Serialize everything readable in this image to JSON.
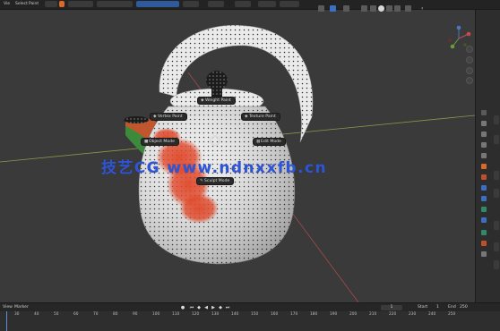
{
  "menubar": {
    "items": [
      "Vie",
      "Select",
      "Paint"
    ]
  },
  "pie_menu": {
    "top": "Weight Paint",
    "upper_left": "Vertex Paint",
    "upper_right": "Texture Paint",
    "left": "Object Mode",
    "right": "Edit Mode",
    "bottom": "Sculpt Mode"
  },
  "watermark": "技艺CG www.ndnxxfb.cn",
  "timeline": {
    "view_label": "View",
    "marker_label": "Marker",
    "current_frame": "1",
    "start_label": "Start",
    "start_value": "1",
    "end_label": "End",
    "end_value": "250"
  },
  "ruler_ticks": [
    "30",
    "40",
    "50",
    "60",
    "70",
    "80",
    "90",
    "100",
    "110",
    "120",
    "130",
    "140",
    "150",
    "160",
    "170",
    "180",
    "190",
    "200",
    "210",
    "220",
    "230",
    "240",
    "250"
  ],
  "colors": {
    "accent": "#5d8ed8",
    "paint_red": "#e0492b",
    "watermark": "#2d55d6"
  }
}
